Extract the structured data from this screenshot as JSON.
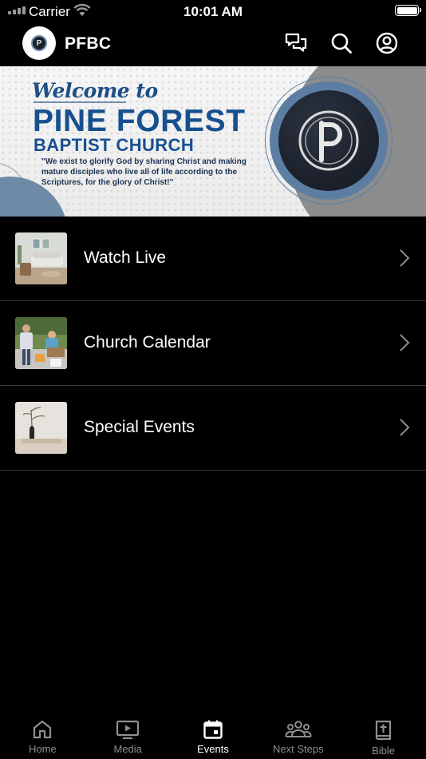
{
  "status_bar": {
    "carrier": "Carrier",
    "time": "10:01 AM"
  },
  "header": {
    "app_title": "PFBC",
    "icons": [
      "chat-icon",
      "search-icon",
      "profile-icon"
    ]
  },
  "banner": {
    "welcome": "Welcome to",
    "church_name": "PINE FOREST",
    "church_subtitle": "BAPTIST CHURCH",
    "mission": "\"We exist to glorify God by sharing Christ and making mature disciples who live all of life according to the Scriptures, for the glory of Christ!\"",
    "emblem_letter": "P"
  },
  "list": {
    "items": [
      {
        "label": "Watch Live",
        "thumb": "living-room-photo"
      },
      {
        "label": "Church Calendar",
        "thumb": "outdoor-event-photo"
      },
      {
        "label": "Special Events",
        "thumb": "vase-plant-photo"
      }
    ]
  },
  "tabs": {
    "items": [
      {
        "label": "Home",
        "icon": "home-icon"
      },
      {
        "label": "Media",
        "icon": "media-icon"
      },
      {
        "label": "Events",
        "icon": "calendar-icon"
      },
      {
        "label": "Next Steps",
        "icon": "group-icon"
      },
      {
        "label": "Bible",
        "icon": "bible-icon"
      }
    ],
    "active": "Events"
  },
  "colors": {
    "background": "#000000",
    "brand_blue": "#17508f",
    "inactive_tab": "#8e8e93",
    "separator": "#3a3a3c"
  }
}
